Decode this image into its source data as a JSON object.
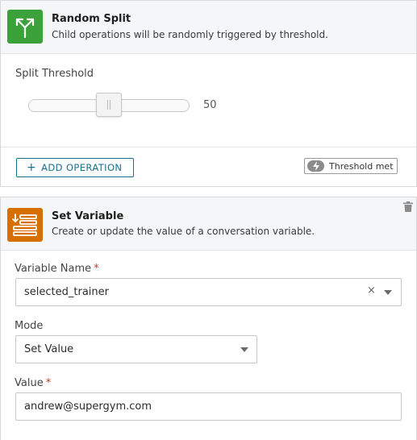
{
  "random_split": {
    "title": "Random Split",
    "description": "Child operations will be randomly triggered by threshold.",
    "icon": "split-arrows-icon",
    "icon_color": "#3ba23b",
    "split_threshold_label": "Split Threshold",
    "slider_value": "50",
    "slider_fraction": 0.5,
    "add_operation_label": "ADD OPERATION",
    "add_operation_icon": "plus-icon",
    "badge_label": "Threshold met",
    "badge_icon": "lightning-icon"
  },
  "set_variable": {
    "title": "Set Variable",
    "description": "Create or update the value of a conversation variable.",
    "icon": "variable-list-icon",
    "icon_color": "#d46f00",
    "delete_icon": "trash-icon",
    "variable_name_label": "Variable Name",
    "variable_name_required": "*",
    "variable_name_value": "selected_trainer",
    "clear_symbol": "×",
    "mode_label": "Mode",
    "mode_value": "Set Value",
    "value_label": "Value",
    "value_required": "*",
    "value_value": "andrew@supergym.com"
  },
  "colors": {
    "accent": "#17718f",
    "required": "#c0392b"
  }
}
